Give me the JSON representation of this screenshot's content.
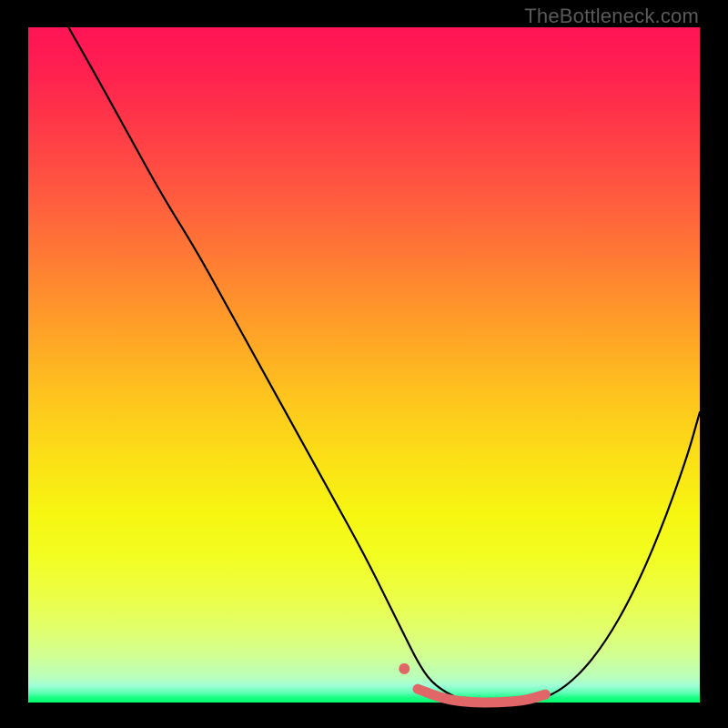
{
  "watermark": "TheBottleneck.com",
  "chart_data": {
    "type": "line",
    "title": "",
    "xlabel": "",
    "ylabel": "",
    "xlim": [
      0,
      100
    ],
    "ylim": [
      0,
      100
    ],
    "grid": false,
    "legend": false,
    "series": [
      {
        "name": "bottleneck-curve",
        "color": "#000000",
        "x": [
          6,
          10,
          15,
          20,
          25,
          30,
          35,
          40,
          45,
          50,
          54,
          56,
          58,
          60,
          63,
          66,
          70,
          74,
          78,
          82,
          86,
          90,
          94,
          98,
          100
        ],
        "y": [
          100,
          93,
          84,
          75,
          67,
          58,
          49,
          40,
          31,
          22,
          14,
          10,
          6,
          3,
          1,
          0,
          0,
          0,
          1,
          4,
          9,
          16,
          25,
          36,
          43
        ]
      },
      {
        "name": "highlight-flat-region",
        "color": "#e06667",
        "x": [
          58,
          62,
          66,
          70,
          74,
          77
        ],
        "y": [
          2,
          0.5,
          0,
          0,
          0.3,
          1.2
        ]
      }
    ],
    "annotations": [
      {
        "type": "dot",
        "name": "highlight-start-dot",
        "x": 56,
        "y": 5,
        "color": "#e06667"
      }
    ],
    "background_gradient": {
      "direction": "top-to-bottom",
      "stops": [
        {
          "pos": 0,
          "color": "#ff1456"
        },
        {
          "pos": 50,
          "color": "#fec21e"
        },
        {
          "pos": 75,
          "color": "#f6f611"
        },
        {
          "pos": 100,
          "color": "#00ff6e"
        }
      ]
    }
  }
}
